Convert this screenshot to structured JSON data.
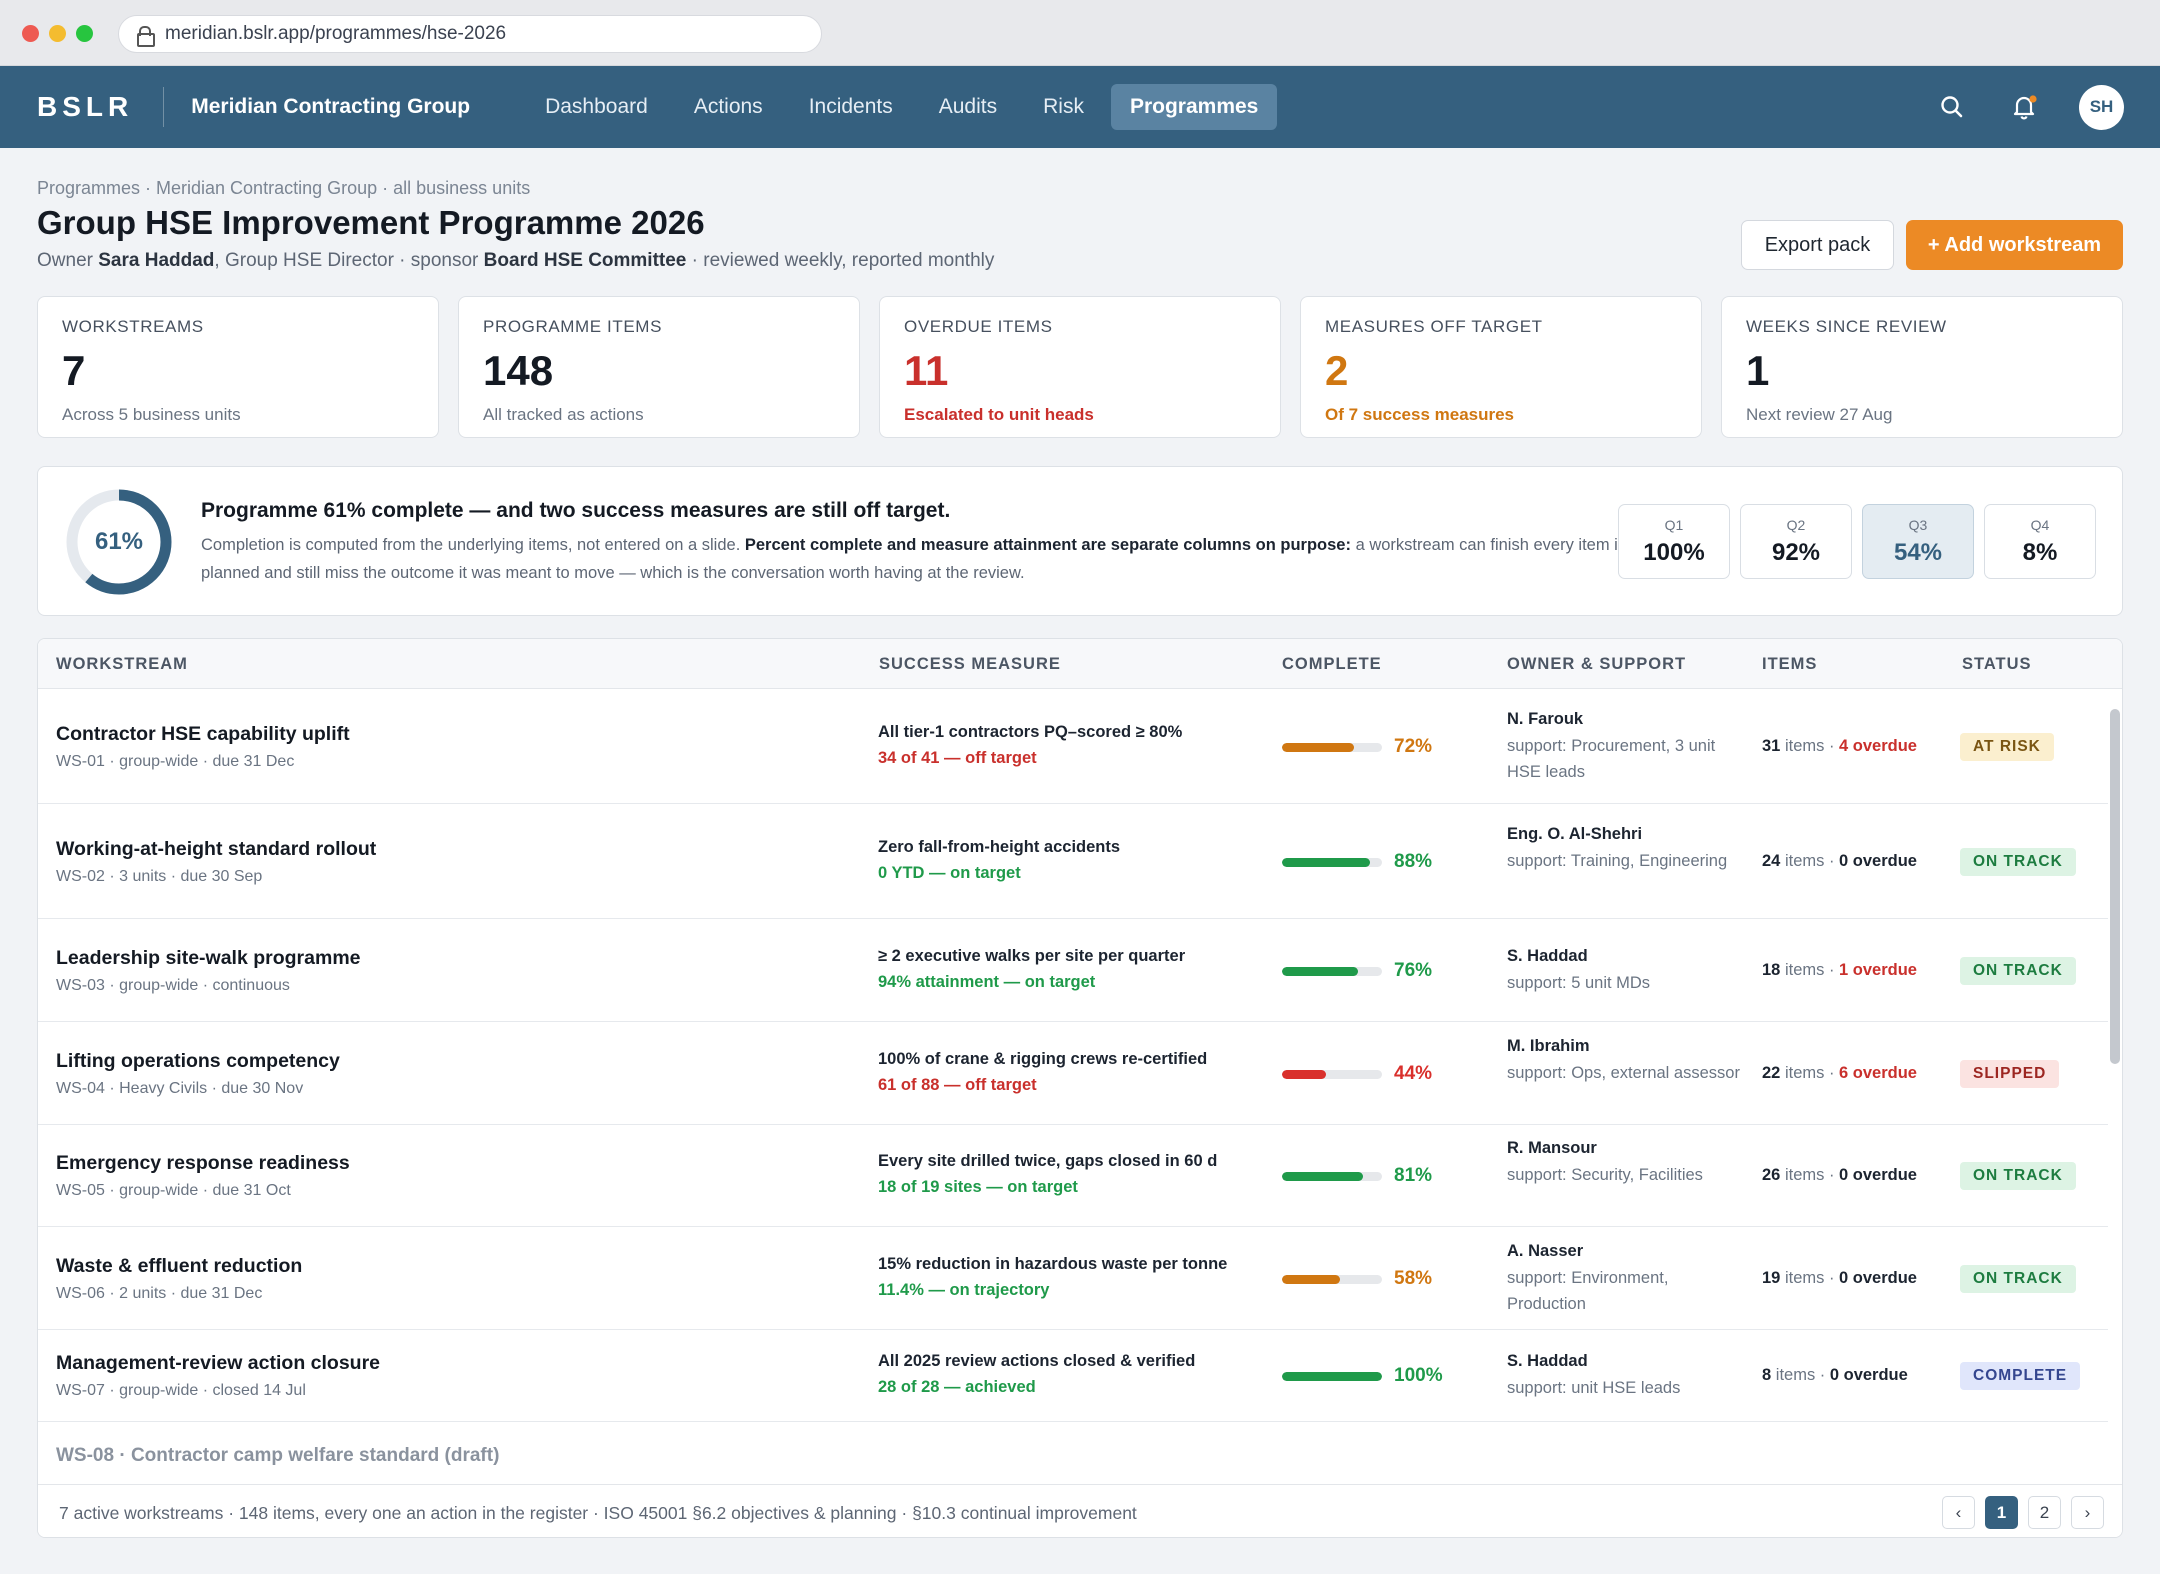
{
  "browser": {
    "url": "meridian.bslr.app/programmes/hse-2026"
  },
  "nav": {
    "logo": "BSLR",
    "org": "Meridian Contracting Group",
    "links": [
      "Dashboard",
      "Actions",
      "Incidents",
      "Audits",
      "Risk",
      "Programmes"
    ],
    "active": "Programmes",
    "avatar": "SH"
  },
  "page": {
    "breadcrumb": "Programmes · Meridian Contracting Group · all business units",
    "title": "Group HSE Improvement Programme 2026",
    "sub_pre": "Owner ",
    "owner": "Sara Haddad",
    "sub_mid": ", Group HSE Director · sponsor ",
    "sponsor": "Board HSE Committee",
    "sub_post": " · reviewed weekly, reported monthly",
    "export_label": "Export pack",
    "add_label": "+ Add workstream"
  },
  "kpis": [
    {
      "label": "WORKSTREAMS",
      "value": "7",
      "note": "Across 5 business units",
      "tone": ""
    },
    {
      "label": "PROGRAMME ITEMS",
      "value": "148",
      "note": "All tracked as actions",
      "tone": ""
    },
    {
      "label": "OVERDUE ITEMS",
      "value": "11",
      "note": "Escalated to unit heads",
      "tone": "red"
    },
    {
      "label": "MEASURES OFF TARGET",
      "value": "2",
      "note": "Of 7 success measures",
      "tone": "orange"
    },
    {
      "label": "WEEKS SINCE REVIEW",
      "value": "1",
      "note": "Next review 27 Aug",
      "tone": ""
    }
  ],
  "banner": {
    "percent": 61,
    "percent_label": "61%",
    "headline": "Programme 61% complete — and two success measures are still off target.",
    "text_pre": "Completion is computed from the underlying items, not entered on a slide. ",
    "text_bold": "Percent complete and measure attainment are separate columns on purpose:",
    "text_post": " a workstream can finish every item it planned and still miss the outcome it was meant to move — which is the conversation worth having at the review.",
    "quarters": [
      {
        "label": "Q1",
        "value": "100%"
      },
      {
        "label": "Q2",
        "value": "92%"
      },
      {
        "label": "Q3",
        "value": "54%"
      },
      {
        "label": "Q4",
        "value": "8%"
      }
    ],
    "current_quarter": "Q3"
  },
  "table": {
    "headers": [
      "WORKSTREAM",
      "SUCCESS MEASURE",
      "COMPLETE",
      "OWNER & SUPPORT",
      "ITEMS",
      "STATUS"
    ],
    "rows": [
      {
        "name": "Contractor HSE capability uplift",
        "meta": "WS-01 · group-wide · due 31 Dec",
        "measure": "All tier-1 contractors PQ–scored ≥ 80%",
        "measure_status": "34 of 41 — off target",
        "measure_tone": "red",
        "complete": 72,
        "complete_label": "72%",
        "color": "#d07711",
        "owner": "N. Farouk",
        "support": "support: Procurement, 3 unit HSE leads",
        "items_n": "31",
        "items_word": " items · ",
        "overdue": "4 overdue",
        "overdue_tone": "red",
        "status": "AT RISK",
        "status_kind": "atrisk"
      },
      {
        "name": "Working-at-height standard rollout",
        "meta": "WS-02 · 3 units · due 30 Sep",
        "measure": "Zero fall-from-height accidents",
        "measure_status": "0 YTD — on target",
        "measure_tone": "green",
        "complete": 88,
        "complete_label": "88%",
        "color": "#1f9a4a",
        "owner": "Eng. O. Al-Shehri",
        "support": "support: Training, Engineering",
        "items_n": "24",
        "items_word": " items · ",
        "overdue": "0 overdue",
        "overdue_tone": "zero",
        "status": "ON TRACK",
        "status_kind": "ontrack"
      },
      {
        "name": "Leadership site-walk programme",
        "meta": "WS-03 · group-wide · continuous",
        "measure": "≥ 2 executive walks per site per quarter",
        "measure_status": "94% attainment — on target",
        "measure_tone": "green",
        "complete": 76,
        "complete_label": "76%",
        "color": "#1f9a4a",
        "owner": "S. Haddad",
        "support": "support: 5 unit MDs",
        "items_n": "18",
        "items_word": " items · ",
        "overdue": "1 overdue",
        "overdue_tone": "red",
        "status": "ON TRACK",
        "status_kind": "ontrack"
      },
      {
        "name": "Lifting operations competency",
        "meta": "WS-04 · Heavy Civils · due 30 Nov",
        "measure": "100% of crane & rigging crews re-certified",
        "measure_status": "61 of 88 — off target",
        "measure_tone": "red",
        "complete": 44,
        "complete_label": "44%",
        "color": "#d9302c",
        "owner": "M. Ibrahim",
        "support": "support: Ops, external assessor",
        "items_n": "22",
        "items_word": " items · ",
        "overdue": "6 overdue",
        "overdue_tone": "red",
        "status": "SLIPPED",
        "status_kind": "slipped"
      },
      {
        "name": "Emergency response readiness",
        "meta": "WS-05 · group-wide · due 31 Oct",
        "measure": "Every site drilled twice, gaps closed in 60 d",
        "measure_status": "18 of 19 sites — on target",
        "measure_tone": "green",
        "complete": 81,
        "complete_label": "81%",
        "color": "#1f9a4a",
        "owner": "R. Mansour",
        "support": "support: Security, Facilities",
        "items_n": "26",
        "items_word": " items · ",
        "overdue": "0 overdue",
        "overdue_tone": "zero",
        "status": "ON TRACK",
        "status_kind": "ontrack"
      },
      {
        "name": "Waste & effluent reduction",
        "meta": "WS-06 · 2 units · due 31 Dec",
        "measure": "15% reduction in hazardous waste per tonne",
        "measure_status": "11.4% — on trajectory",
        "measure_tone": "green",
        "complete": 58,
        "complete_label": "58%",
        "color": "#d07711",
        "owner": "A. Nasser",
        "support": "support: Environment, Production",
        "items_n": "19",
        "items_word": " items · ",
        "overdue": "0 overdue",
        "overdue_tone": "zero",
        "status": "ON TRACK",
        "status_kind": "ontrack"
      },
      {
        "name": "Management-review action closure",
        "meta": "WS-07 · group-wide · closed 14 Jul",
        "measure": "All 2025 review actions closed & verified",
        "measure_status": "28 of 28 — achieved",
        "measure_tone": "green",
        "complete": 100,
        "complete_label": "100%",
        "color": "#1f9a4a",
        "owner": "S. Haddad",
        "support": "support: unit HSE leads",
        "items_n": "8",
        "items_word": " items · ",
        "overdue": "0 overdue",
        "overdue_tone": "zero",
        "status": "COMPLETE",
        "status_kind": "complete"
      }
    ],
    "draft_row": "WS-08 · Contractor camp welfare standard (draft)",
    "footer": "7 active workstreams · 148 items, every one an action in the register · ISO 45001 §6.2 objectives & planning · §10.3 continual improvement",
    "pager": {
      "prev": "‹",
      "pages": [
        "1",
        "2"
      ],
      "current": "1",
      "next": "›"
    }
  }
}
